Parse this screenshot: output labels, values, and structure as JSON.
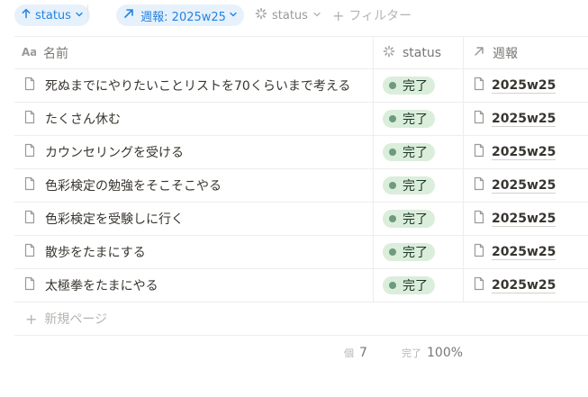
{
  "filter_bar": {
    "sort_chip": {
      "label": "status",
      "icon": "arrow-up-icon"
    },
    "filter_chip": {
      "label": "週報: 2025w25",
      "icon": "arrow-up-right-icon"
    },
    "status_filter": {
      "label": "status",
      "icon": "loading-spinner-icon"
    },
    "add_filter": {
      "label": "フィルター",
      "icon": "plus-icon"
    }
  },
  "table": {
    "columns": {
      "name": {
        "label": "名前",
        "icon": "text-aa-icon"
      },
      "status": {
        "label": "status",
        "icon": "loading-spinner-icon"
      },
      "weekly": {
        "label": "週報",
        "icon": "arrow-up-right-icon"
      }
    },
    "rows": [
      {
        "name": "死ぬまでにやりたいことリストを70くらいまで考える",
        "status": "完了",
        "weekly": "2025w25"
      },
      {
        "name": "たくさん休む",
        "status": "完了",
        "weekly": "2025w25"
      },
      {
        "name": "カウンセリングを受ける",
        "status": "完了",
        "weekly": "2025w25"
      },
      {
        "name": "色彩検定の勉強をそこそこやる",
        "status": "完了",
        "weekly": "2025w25"
      },
      {
        "name": "色彩検定を受験しに行く",
        "status": "完了",
        "weekly": "2025w25"
      },
      {
        "name": "散歩をたまにする",
        "status": "完了",
        "weekly": "2025w25"
      },
      {
        "name": "太極拳をたまにやる",
        "status": "完了",
        "weekly": "2025w25"
      }
    ],
    "new_page_label": "新規ページ"
  },
  "summary": {
    "count_label": "個",
    "count_value": "7",
    "done_label": "完了",
    "done_value": "100%"
  },
  "colors": {
    "accent": "#2383e2",
    "chip_bg": "#e7f1fb",
    "done_badge_bg": "#dbeddb",
    "done_dot": "#6c9b7d"
  }
}
